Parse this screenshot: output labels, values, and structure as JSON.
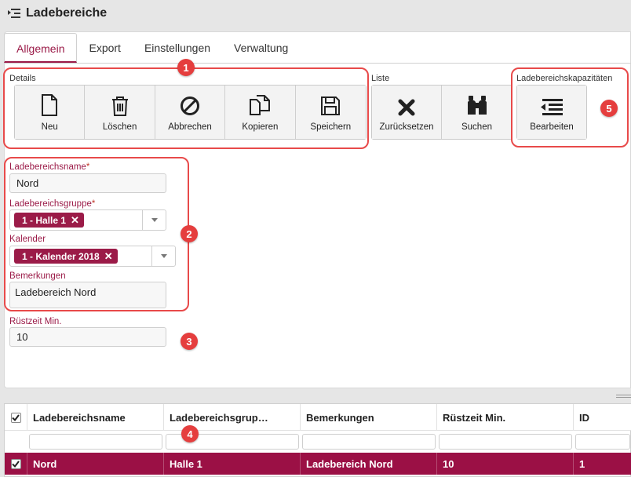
{
  "window": {
    "title": "Ladebereiche"
  },
  "tabs": [
    "Allgemein",
    "Export",
    "Einstellungen",
    "Verwaltung"
  ],
  "toolbar": {
    "details": {
      "label": "Details",
      "buttons": [
        {
          "label": "Neu",
          "icon": "new-file-icon"
        },
        {
          "label": "Löschen",
          "icon": "trash-icon"
        },
        {
          "label": "Abbrechen",
          "icon": "cancel-icon"
        },
        {
          "label": "Kopieren",
          "icon": "copy-icon"
        },
        {
          "label": "Speichern",
          "icon": "save-icon"
        }
      ]
    },
    "liste": {
      "label": "Liste",
      "buttons": [
        {
          "label": "Zurücksetzen",
          "icon": "reset-x-icon"
        },
        {
          "label": "Suchen",
          "icon": "binoculars-icon"
        }
      ]
    },
    "kapazitaeten": {
      "label": "Ladebereichskapazitäten",
      "buttons": [
        {
          "label": "Bearbeiten",
          "icon": "edit-list-icon"
        }
      ]
    }
  },
  "form": {
    "name": {
      "label": "Ladebereichsname",
      "required": "*",
      "value": "Nord"
    },
    "gruppe": {
      "label": "Ladebereichsgruppe",
      "required": "*",
      "chip": "1 - Halle 1"
    },
    "kalender": {
      "label": "Kalender",
      "chip": "1 - Kalender 2018"
    },
    "bemerkungen": {
      "label": "Bemerkungen",
      "value": "Ladebereich Nord"
    },
    "ruestzeit": {
      "label": "Rüstzeit Min.",
      "value": "10"
    }
  },
  "callouts": [
    "1",
    "2",
    "3",
    "4",
    "5"
  ],
  "grid": {
    "columns": [
      "Ladebereichsname",
      "Ladebereichsgrup…",
      "Bemerkungen",
      "Rüstzeit Min.",
      "ID"
    ],
    "rows": [
      {
        "cells": [
          "Nord",
          "Halle 1",
          "Ladebereich Nord",
          "10",
          "1"
        ],
        "selected": true
      }
    ]
  },
  "colors": {
    "accent": "#9b1b48",
    "selected_row": "#9b1045",
    "callout": "#e84a4a"
  }
}
